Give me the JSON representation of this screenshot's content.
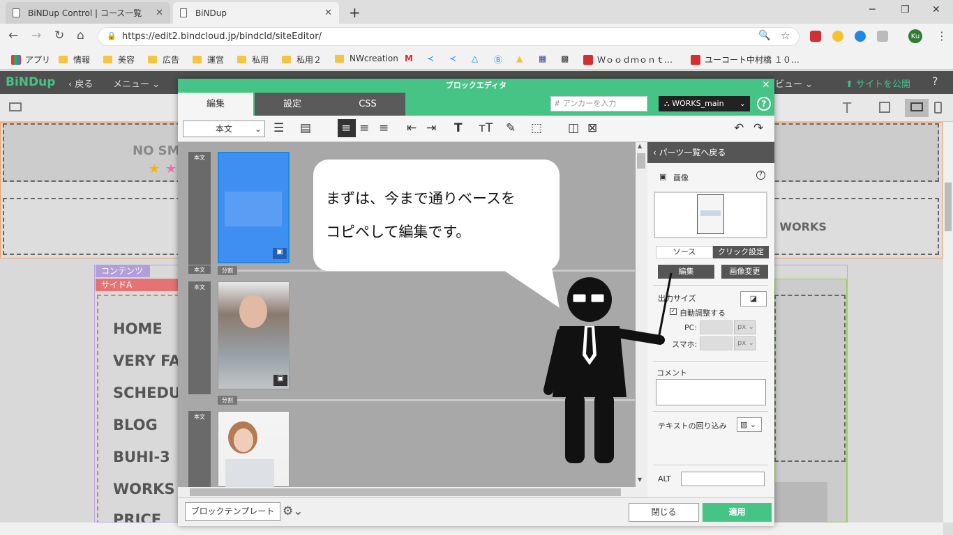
{
  "browser": {
    "tabs": [
      {
        "title": "BiNDup Control | コース一覧",
        "active": false
      },
      {
        "title": "BiNDup",
        "active": true
      }
    ],
    "url": "https://edit2.bindcloud.jp/bindcld/siteEditor/",
    "profile_initials": "Ku",
    "bookmarks": [
      "アプリ",
      "情報",
      "美容",
      "広告",
      "運営",
      "私用",
      "私用２",
      "NWcreation",
      "Ｗｏｏｄｍｏｎｔ…",
      "ユーコート中村橋 １０…"
    ]
  },
  "bindup": {
    "logo": "BiNDup",
    "back_label": "戻る",
    "menu_label": "メニュー",
    "preview_label": "プレビュー",
    "publish_label": "サイトを公開",
    "accent_color": "#45c486"
  },
  "background_page": {
    "content_label": "コンテンツ",
    "side_label": "サイドA",
    "works_text": "| WORKS",
    "nosmoke_text": "NO SM",
    "menu_items": [
      "HOME",
      "VERY FA",
      "SCHEDU",
      "BLOG",
      "BUHI-3",
      "WORKS",
      "PRICE"
    ]
  },
  "block_editor": {
    "title": "ブロックエディタ",
    "tabs": [
      "編集",
      "設定",
      "CSS"
    ],
    "anchor_placeholder": "アンカーを入力",
    "block_select": "WORKS_main",
    "style_select": "本文",
    "block_label": "本文",
    "divider_label": "分割",
    "footer": {
      "template_btn": "ブロックテンプレート",
      "close_btn": "閉じる",
      "apply_btn": "適用"
    }
  },
  "parts_panel": {
    "back_label": "パーツ一覧へ戻る",
    "section_title": "画像",
    "tabs": [
      "ソース",
      "クリック設定"
    ],
    "edit_btn": "編集",
    "change_btn": "画像変更",
    "output_size_label": "出力サイズ",
    "auto_adjust_label": "自動調整する",
    "pc_label": "PC:",
    "sp_label": "スマホ:",
    "unit": "px",
    "comment_label": "コメント",
    "wrap_label": "テキストの回り込み",
    "alt_label": "ALT"
  },
  "annotation": {
    "line1": "まずは、今まで通りベースを",
    "line2": "コピペして編集です。"
  }
}
